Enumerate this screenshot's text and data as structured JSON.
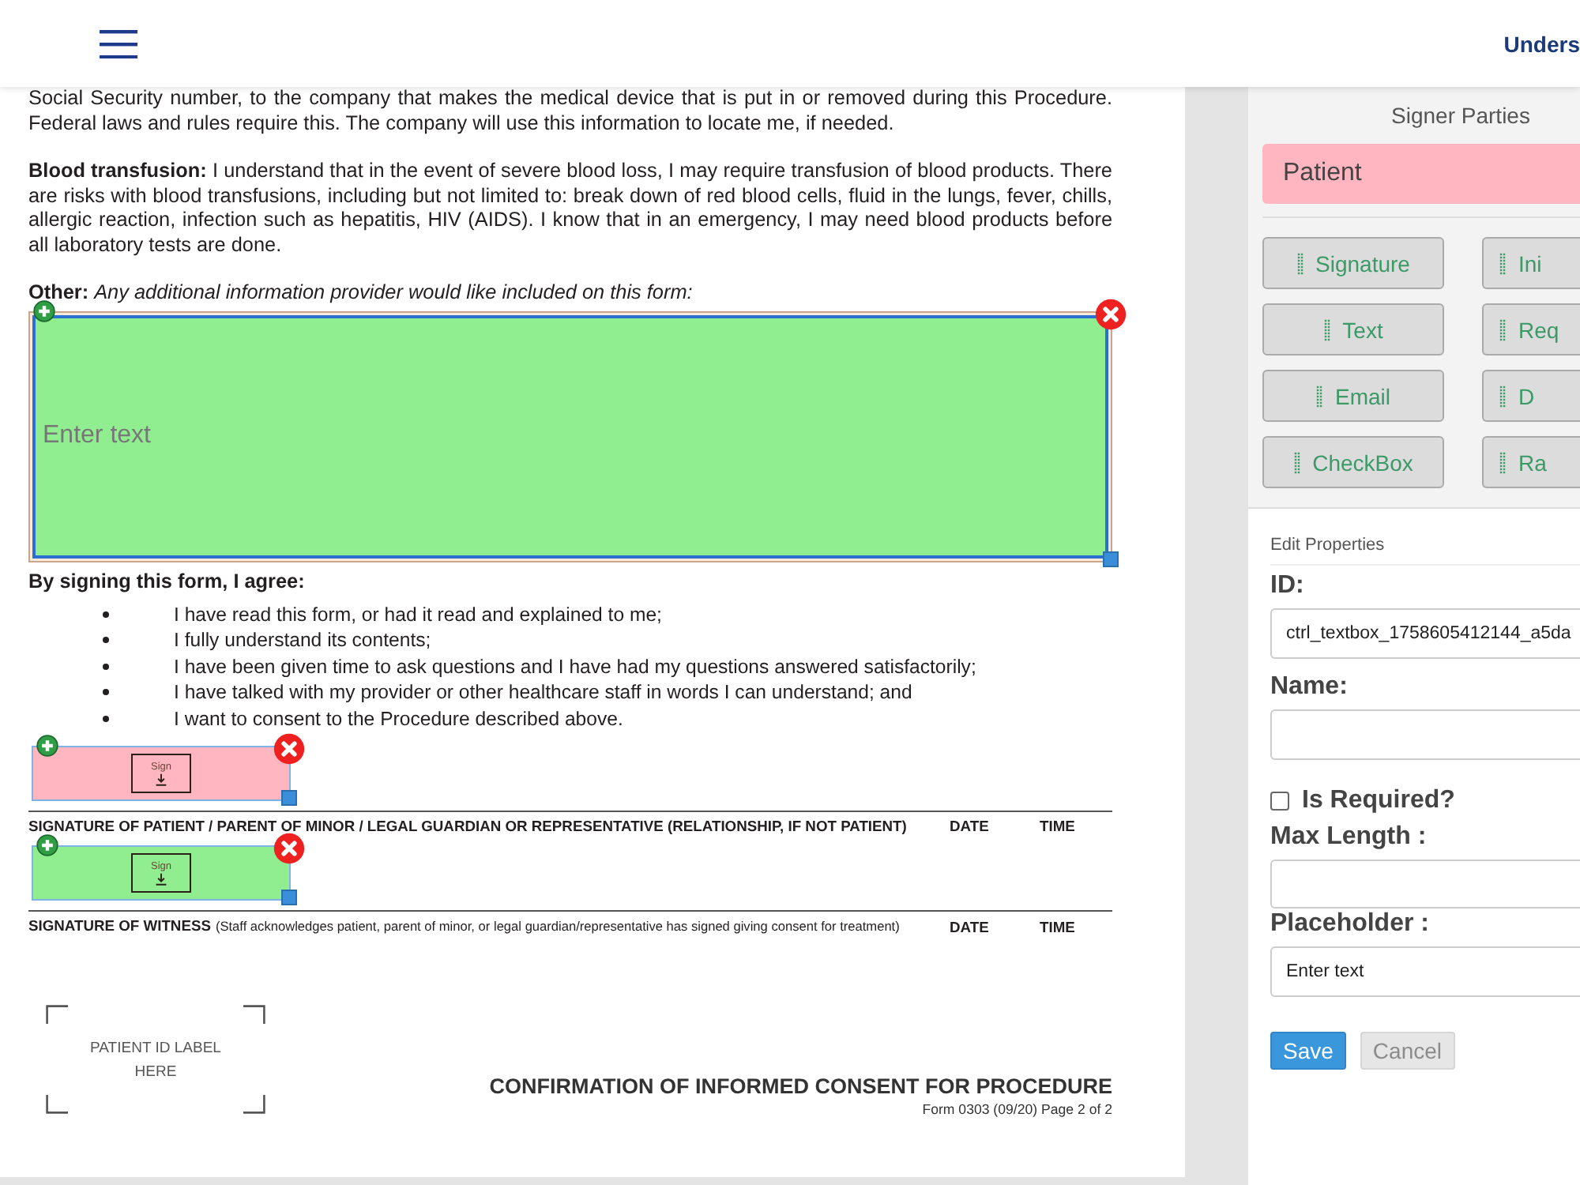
{
  "header": {
    "title": "Unders"
  },
  "document": {
    "blocks": [
      {
        "kind": "paragraph",
        "text": "Social Security number, to the company that makes the medical device that is put in or removed during this Procedure. Federal laws and rules require this. The company will use this information to locate me, if needed."
      },
      {
        "kind": "paragraph",
        "text": "**Blood transfusion:** I understand that in the event of severe blood loss, I may require transfusion of blood products. There are risks with blood transfusions, including but not limited to: break down of red blood cells, fluid in the lungs, fever, chills, allergic reaction, infection such as hepatitis, HIV (AIDS). I know that in an emergency, I may need blood products before all laboratory tests are done."
      },
      {
        "kind": "label",
        "text": "**Other:** *Any additional information provider would like included on this form:*"
      },
      {
        "kind": "text_field",
        "placeholder": "Enter text",
        "color": "#90ee90"
      },
      {
        "kind": "heading",
        "text": "By signing this form, I agree:"
      },
      {
        "kind": "bullets",
        "items": [
          "I have read this form, or had it read and explained to me;",
          "I fully understand its contents;",
          "I have been given time to ask questions and I have had my questions answered satisfactorily;",
          "I have talked with my provider or other healthcare staff in words I can understand; and",
          "I want to consent to the Procedure described above."
        ]
      },
      {
        "kind": "sign_field",
        "label": "Sign",
        "color": "#ffb6c1"
      },
      {
        "kind": "signature_line",
        "caption": "SIGNATURE OF PATIENT / PARENT OF MINOR / LEGAL GUARDIAN OR REPRESENTATIVE (RELATIONSHIP, IF NOT PATIENT)",
        "date": "DATE",
        "time": "TIME"
      },
      {
        "kind": "sign_field",
        "label": "Sign",
        "color": "#90ee90"
      },
      {
        "kind": "signature_line",
        "caption": "SIGNATURE OF WITNESS",
        "note": "(Staff acknowledges patient, parent of minor, or legal guardian/representative has signed giving consent for treatment)",
        "date": "DATE",
        "time": "TIME"
      }
    ],
    "id_label": "PATIENT ID LABEL HERE",
    "footer": {
      "title": "CONFIRMATION OF INFORMED CONSENT FOR PROCEDURE",
      "form": "Form 0303 (09/20) Page 2 of 2"
    }
  },
  "panel": {
    "signers_title": "Signer Parties",
    "signers": [
      {
        "name": "Patient",
        "color": "#ffb6c1"
      }
    ],
    "tools": [
      "Signature",
      "Ini",
      "Text",
      "Req",
      "Email",
      "D",
      "CheckBox",
      "Ra"
    ],
    "properties": {
      "title": "Edit Properties",
      "fields": [
        {
          "kind": "input",
          "label": "ID:",
          "value": "ctrl_textbox_1758605412144_a5da"
        },
        {
          "kind": "input",
          "label": "Name:"
        },
        {
          "kind": "checkbox",
          "label": "Is Required?",
          "checked": false
        },
        {
          "kind": "input",
          "label": "Max Length :"
        },
        {
          "kind": "input",
          "label": "Placeholder :",
          "value": "Enter text"
        }
      ],
      "buttons": [
        {
          "label": "Save",
          "disabled": false
        },
        {
          "label": "Cancel",
          "disabled": true
        }
      ]
    }
  }
}
